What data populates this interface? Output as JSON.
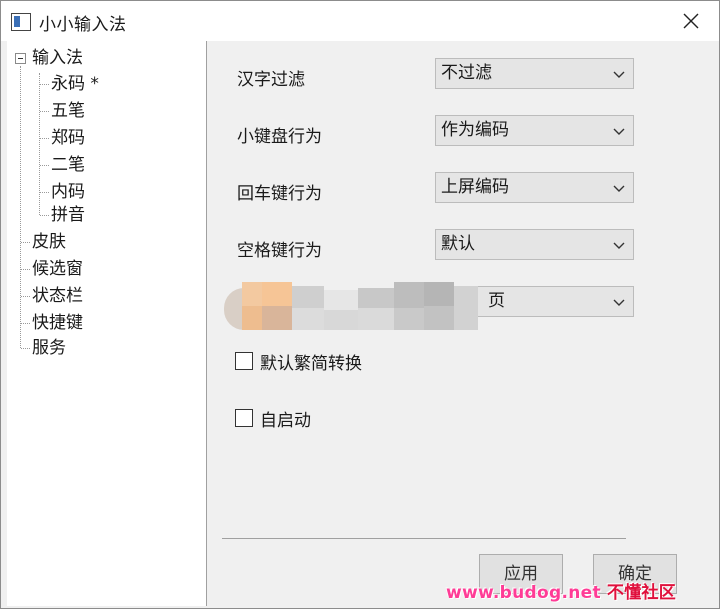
{
  "window": {
    "title": "小小输入法",
    "app_icon": "app-window-icon",
    "close_icon": "close-icon"
  },
  "tree": {
    "root": {
      "label": "输入法",
      "expander_icon": "collapse-box-icon"
    },
    "children": [
      {
        "label": "永码 *"
      },
      {
        "label": "五笔"
      },
      {
        "label": "郑码"
      },
      {
        "label": "二笔"
      },
      {
        "label": "内码"
      },
      {
        "label": "拼音"
      }
    ],
    "siblings": [
      {
        "label": "皮肤"
      },
      {
        "label": "候选窗"
      },
      {
        "label": "状态栏"
      },
      {
        "label": "快捷键"
      },
      {
        "label": "服务"
      }
    ]
  },
  "settings": {
    "hanzi_filter": {
      "label": "汉字过滤",
      "value": "不过滤"
    },
    "numpad": {
      "label": "小键盘行为",
      "value": "作为编码"
    },
    "enter_key": {
      "label": "回车键行为",
      "value": "上屏编码"
    },
    "space_key": {
      "label": "空格键行为",
      "value": "默认"
    },
    "obscured": {
      "value_fragment": "页"
    },
    "traditional": {
      "label": "默认繁简转换",
      "checked": false
    },
    "autostart": {
      "label": "自启动",
      "checked": false
    }
  },
  "buttons": {
    "apply": "应用",
    "ok": "确定"
  },
  "watermark": {
    "url": "www.budog.net",
    "name": "不懂社区"
  },
  "colors": {
    "dropdown_bg": "#e5e5e5",
    "panel_bg": "#f0f0f0",
    "watermark_pink": "#ff3c96",
    "watermark_red": "#e0103c"
  }
}
